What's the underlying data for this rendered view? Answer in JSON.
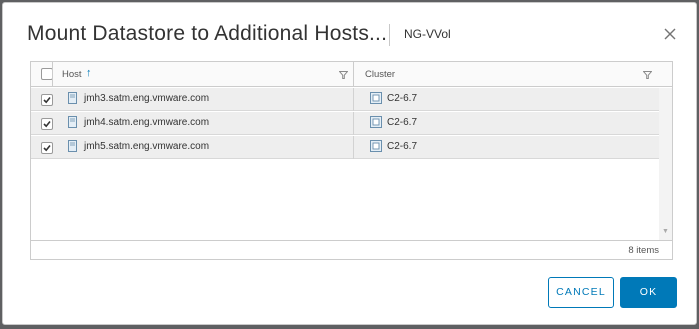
{
  "dialog": {
    "title": "Mount Datastore to Additional Hosts...",
    "subtitle": "NG-VVol",
    "close_icon": "close-icon"
  },
  "grid": {
    "columns": [
      {
        "label": "Host",
        "sort": "ascending"
      },
      {
        "label": "Cluster"
      }
    ],
    "rows": [
      {
        "checked": true,
        "host": "jmh3.satm.eng.vmware.com",
        "cluster": "C2-6.7"
      },
      {
        "checked": true,
        "host": "jmh4.satm.eng.vmware.com",
        "cluster": "C2-6.7"
      },
      {
        "checked": true,
        "host": "jmh5.satm.eng.vmware.com",
        "cluster": "C2-6.7"
      }
    ],
    "footer": "8 items"
  },
  "buttons": {
    "cancel": "CANCEL",
    "ok": "OK"
  },
  "colors": {
    "accent": "#0079b8",
    "row_bg": "#eeeeee",
    "backdrop": "#5f6062"
  }
}
